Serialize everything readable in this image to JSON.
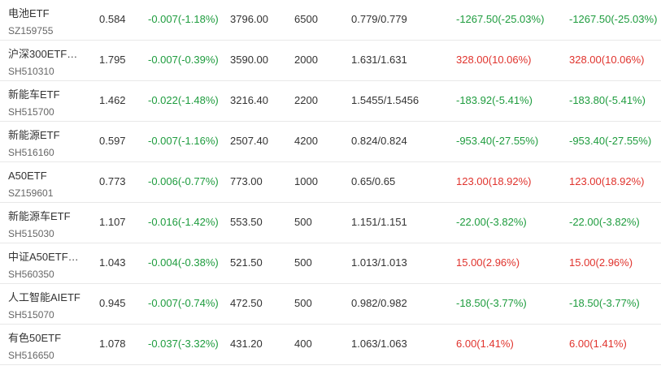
{
  "colors": {
    "up": "#e0332d",
    "down": "#1e9c3e",
    "text": "#333333",
    "subtext": "#666666",
    "divider": "#e8e8e8"
  },
  "rows": [
    {
      "name": "电池ETF",
      "code": "SZ159755",
      "price": "0.584",
      "change": "-0.007(-1.18%)",
      "market_value": "3796.00",
      "quantity": "6500",
      "cost": "0.779/0.779",
      "pl_float": "-1267.50(-25.03%)",
      "pl_total": "-1267.50(-25.03%)",
      "pl_direction": "down"
    },
    {
      "name": "沪深300ETF…",
      "code": "SH510310",
      "price": "1.795",
      "change": "-0.007(-0.39%)",
      "market_value": "3590.00",
      "quantity": "2000",
      "cost": "1.631/1.631",
      "pl_float": "328.00(10.06%)",
      "pl_total": "328.00(10.06%)",
      "pl_direction": "up"
    },
    {
      "name": "新能车ETF",
      "code": "SH515700",
      "price": "1.462",
      "change": "-0.022(-1.48%)",
      "market_value": "3216.40",
      "quantity": "2200",
      "cost": "1.5455/1.5456",
      "pl_float": "-183.92(-5.41%)",
      "pl_total": "-183.80(-5.41%)",
      "pl_direction": "down"
    },
    {
      "name": "新能源ETF",
      "code": "SH516160",
      "price": "0.597",
      "change": "-0.007(-1.16%)",
      "market_value": "2507.40",
      "quantity": "4200",
      "cost": "0.824/0.824",
      "pl_float": "-953.40(-27.55%)",
      "pl_total": "-953.40(-27.55%)",
      "pl_direction": "down"
    },
    {
      "name": "A50ETF",
      "code": "SZ159601",
      "price": "0.773",
      "change": "-0.006(-0.77%)",
      "market_value": "773.00",
      "quantity": "1000",
      "cost": "0.65/0.65",
      "pl_float": "123.00(18.92%)",
      "pl_total": "123.00(18.92%)",
      "pl_direction": "up"
    },
    {
      "name": "新能源车ETF",
      "code": "SH515030",
      "price": "1.107",
      "change": "-0.016(-1.42%)",
      "market_value": "553.50",
      "quantity": "500",
      "cost": "1.151/1.151",
      "pl_float": "-22.00(-3.82%)",
      "pl_total": "-22.00(-3.82%)",
      "pl_direction": "down"
    },
    {
      "name": "中证A50ETF…",
      "code": "SH560350",
      "price": "1.043",
      "change": "-0.004(-0.38%)",
      "market_value": "521.50",
      "quantity": "500",
      "cost": "1.013/1.013",
      "pl_float": "15.00(2.96%)",
      "pl_total": "15.00(2.96%)",
      "pl_direction": "up"
    },
    {
      "name": "人工智能AIETF",
      "code": "SH515070",
      "price": "0.945",
      "change": "-0.007(-0.74%)",
      "market_value": "472.50",
      "quantity": "500",
      "cost": "0.982/0.982",
      "pl_float": "-18.50(-3.77%)",
      "pl_total": "-18.50(-3.77%)",
      "pl_direction": "down"
    },
    {
      "name": "有色50ETF",
      "code": "SH516650",
      "price": "1.078",
      "change": "-0.037(-3.32%)",
      "market_value": "431.20",
      "quantity": "400",
      "cost": "1.063/1.063",
      "pl_float": "6.00(1.41%)",
      "pl_total": "6.00(1.41%)",
      "pl_direction": "up"
    }
  ]
}
